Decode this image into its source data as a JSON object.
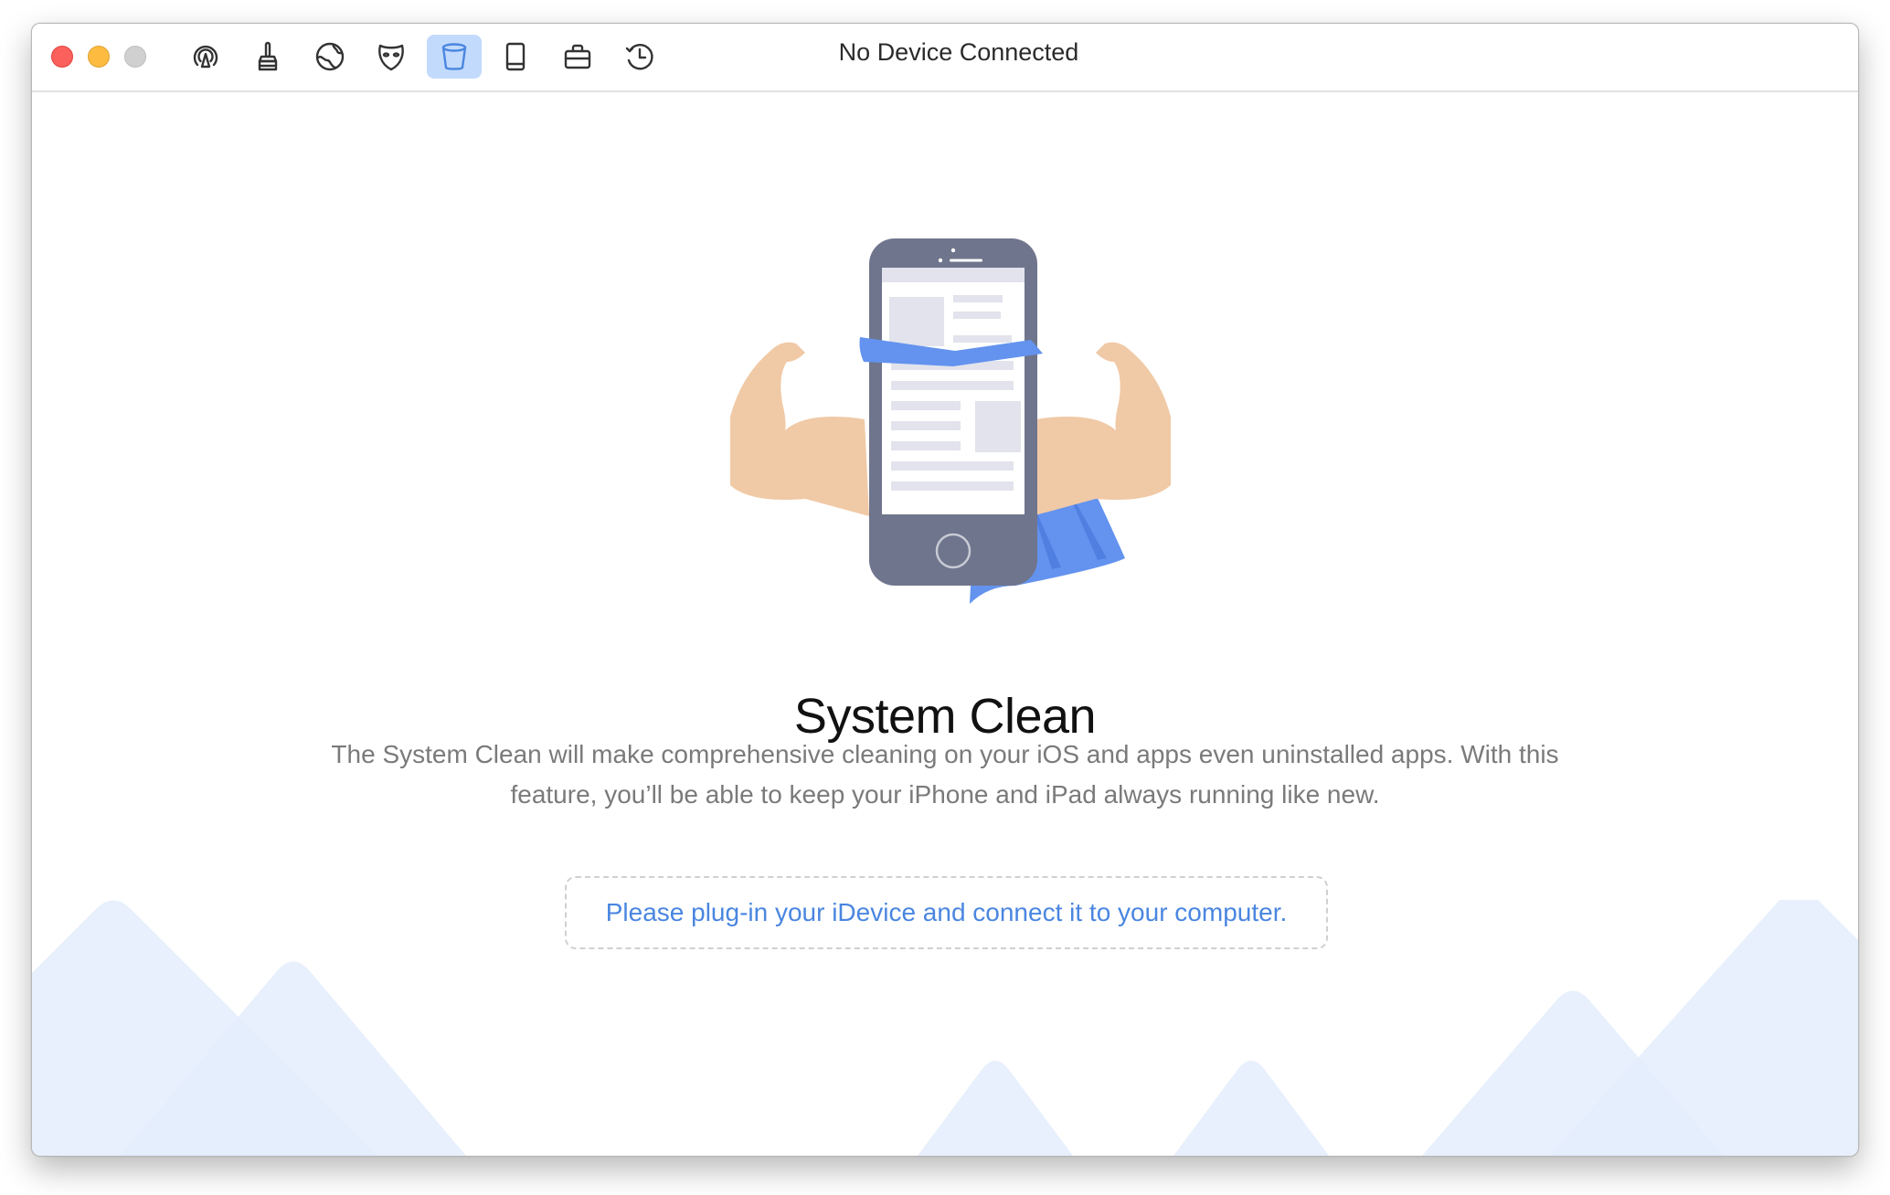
{
  "window": {
    "title": "No Device Connected",
    "traffic_lights": [
      "close",
      "minimize",
      "zoom"
    ]
  },
  "toolbar": {
    "active_index": 4,
    "items": [
      {
        "icon": "airplay-icon",
        "label": "AirBackup"
      },
      {
        "icon": "brush-icon",
        "label": "Cleaner"
      },
      {
        "icon": "globe-icon",
        "label": "Internet Clean"
      },
      {
        "icon": "mask-icon",
        "label": "Privacy Clean"
      },
      {
        "icon": "bin-icon",
        "label": "System Clean"
      },
      {
        "icon": "tablet-icon",
        "label": "Device"
      },
      {
        "icon": "briefcase-icon",
        "label": "Toolbox"
      },
      {
        "icon": "history-icon",
        "label": "History"
      }
    ]
  },
  "main": {
    "heading": "System Clean",
    "description": "The System Clean will make comprehensive cleaning on your iOS and apps even uninstalled apps. With this feature, you’ll be able to keep your iPhone and iPad always running like new.",
    "connect_prompt": "Please plug-in your iDevice and connect it to your computer."
  },
  "colors": {
    "accent": "#4a86e0",
    "active_tab_bg": "#c2dafc",
    "phone_body": "#6f758c",
    "skin": "#f0c9a6",
    "cape": "#6393ef",
    "mountain": "#eaf1fc",
    "mountain_overlap": "#d9e8f9"
  }
}
